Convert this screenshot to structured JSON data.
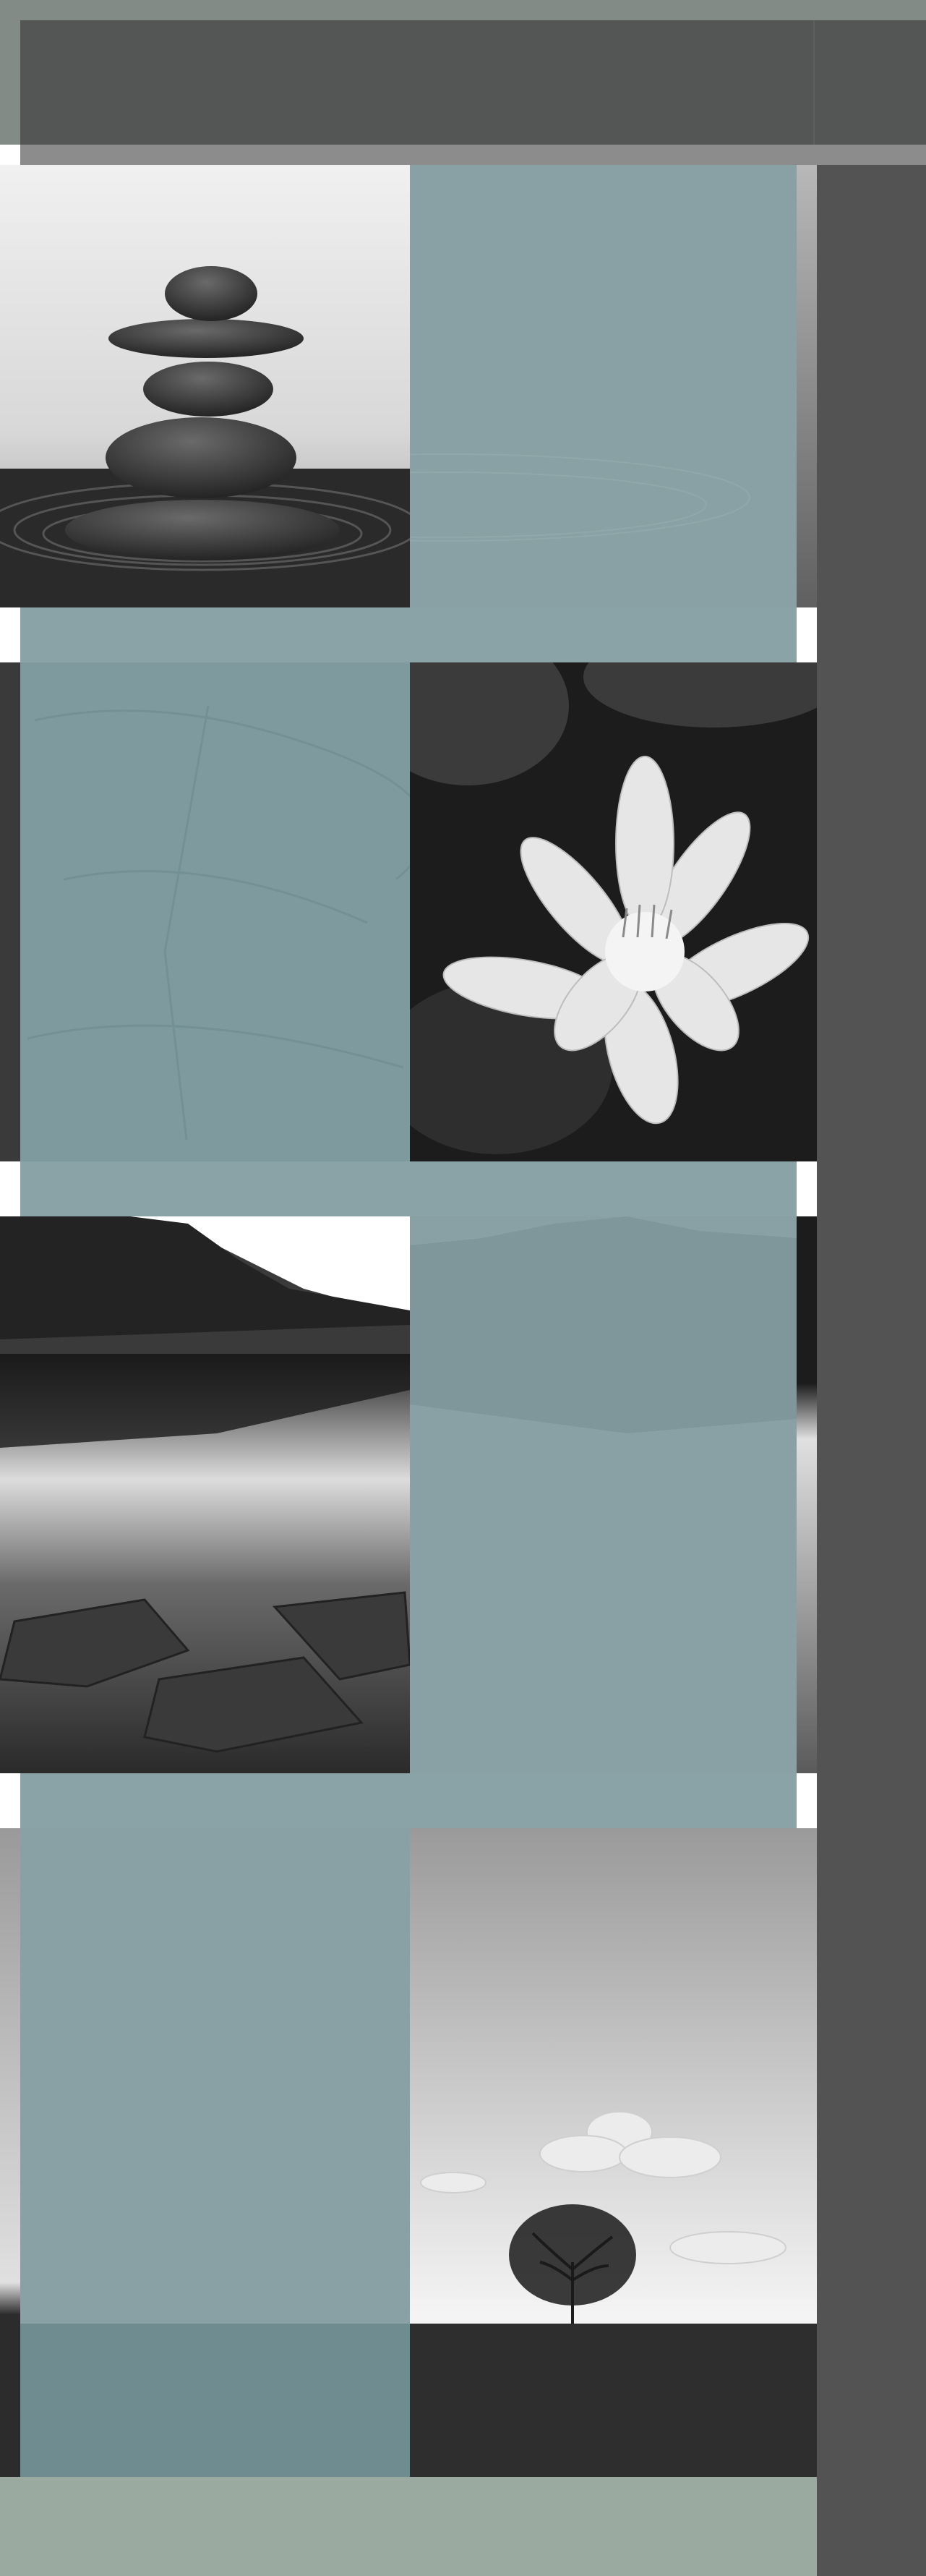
{
  "colors": {
    "header_strip": "#838b86",
    "header_bar": "#535655",
    "header_bottom_strip": "#8c8c8c",
    "sidebar": "#535353",
    "teal_overlay": "#89a1a4",
    "footer": "#9aaaa0"
  },
  "gallery": [
    {
      "icon": "stacked-stones-icon"
    },
    {
      "icon": "water-lily-icon"
    },
    {
      "icon": "mountain-lake-icon"
    },
    {
      "icon": "lone-tree-icon"
    }
  ]
}
